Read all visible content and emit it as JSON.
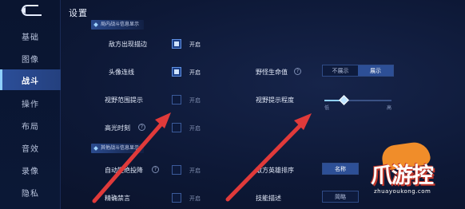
{
  "page": {
    "title": "设置"
  },
  "sidebar": {
    "items": [
      {
        "label": "基础",
        "active": false
      },
      {
        "label": "图像",
        "active": false
      },
      {
        "label": "战斗",
        "active": true
      },
      {
        "label": "操作",
        "active": false
      },
      {
        "label": "布局",
        "active": false
      },
      {
        "label": "音效",
        "active": false
      },
      {
        "label": "录像",
        "active": false
      },
      {
        "label": "隐私",
        "active": false
      }
    ]
  },
  "sections": {
    "top_tag": "局内战斗信息显示",
    "other_tag": "其他战斗信息显示"
  },
  "settings": {
    "enemy_outline": {
      "label": "敌方出现描边",
      "state": "开启"
    },
    "avatar_link": {
      "label": "头像连线",
      "state": "开启"
    },
    "vision_hint": {
      "label": "视野范围提示",
      "state": "开启"
    },
    "highlight": {
      "label": "高光时刻",
      "state": "开启"
    },
    "auto_reject": {
      "label": "自动拒绝投降",
      "state": "开启"
    },
    "precise_ban": {
      "label": "精确禁言",
      "state": "开启"
    }
  },
  "right": {
    "monster_hp": {
      "label": "野怪生命值",
      "options": [
        "不展示",
        "展示"
      ],
      "selected": 1
    },
    "vision_level": {
      "label": "视野提示程度",
      "low": "低",
      "high": "高",
      "value": 0.3
    },
    "hero_sort": {
      "label": "敌方英雄排序",
      "button": "名称"
    },
    "skill_desc": {
      "label": "技能描述",
      "button": "简略"
    }
  },
  "watermark": {
    "brand": "爪游控",
    "url": "zhuayoukong.com"
  },
  "colors": {
    "accent": "#2d4f96",
    "arrow": "#e03a3a",
    "bg": "#0c1632"
  }
}
